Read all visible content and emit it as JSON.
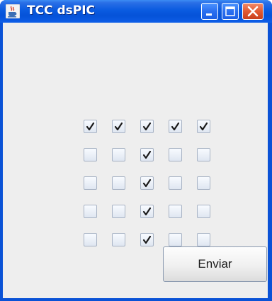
{
  "window": {
    "title": "TCC dsPIC",
    "controls": [
      "minimize",
      "maximize",
      "close"
    ]
  },
  "checkbox_grid": {
    "rows": [
      [
        true,
        true,
        true,
        true,
        true
      ],
      [
        false,
        false,
        true,
        false,
        false
      ],
      [
        false,
        false,
        true,
        false,
        false
      ],
      [
        false,
        false,
        true,
        false,
        false
      ],
      [
        false,
        false,
        true,
        false,
        false
      ]
    ]
  },
  "send_button": {
    "label": "Enviar"
  },
  "icons": {
    "app": "java-cup-icon",
    "minimize": "minimize-icon",
    "maximize": "maximize-icon",
    "close": "close-icon",
    "check": "check-icon"
  },
  "colors": {
    "titlebar": "#0552d8",
    "close_button": "#e25a32",
    "client_background": "#eeeeee",
    "check_mark": "#1a1a1a"
  }
}
